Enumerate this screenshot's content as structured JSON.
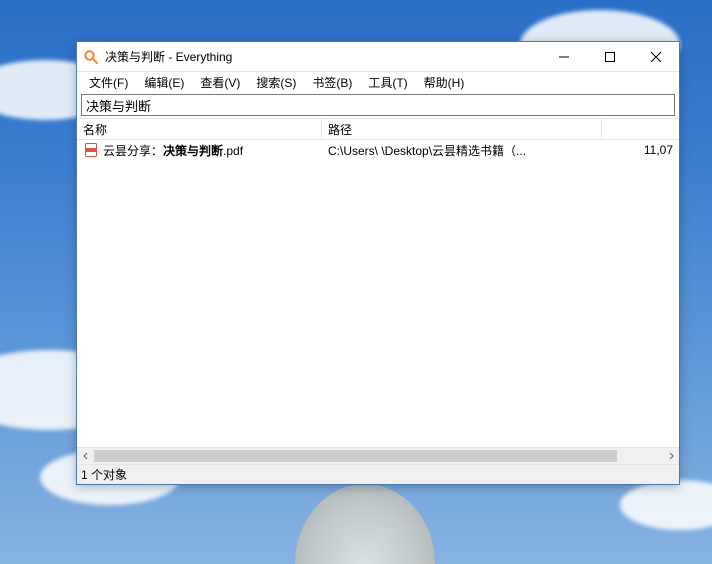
{
  "window": {
    "title": "决策与判断 - Everything"
  },
  "menu": {
    "file": "文件(F)",
    "edit": "编辑(E)",
    "view": "查看(V)",
    "search": "搜索(S)",
    "bookmarks": "书签(B)",
    "tools": "工具(T)",
    "help": "帮助(H)"
  },
  "search": {
    "value": "决策与判断"
  },
  "columns": {
    "name": "名称",
    "path": "路径",
    "size": ""
  },
  "results": [
    {
      "prefix": "云昙分享：",
      "match": "决策与判断",
      "suffix": ".pdf",
      "path": "C:\\Users\\        \\Desktop\\云昙精选书籍（...",
      "size": "11,07"
    }
  ],
  "status": "1 个对象"
}
